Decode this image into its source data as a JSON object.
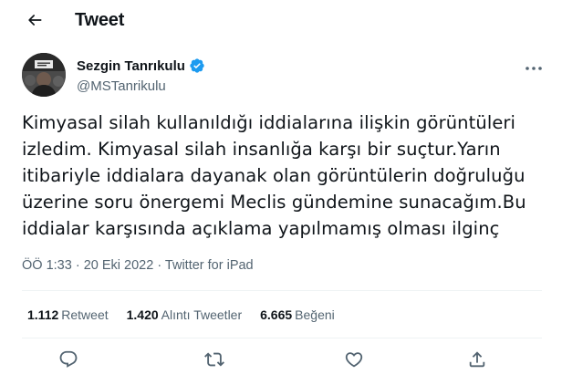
{
  "header": {
    "title": "Tweet",
    "back_icon": "arrow-left-icon"
  },
  "author": {
    "display_name": "Sezgin Tanrıkulu",
    "handle": "@MSTanrikulu",
    "verified_icon": "verified-badge-icon",
    "verified_color": "#1d9bf0",
    "more_icon": "more-horizontal-icon"
  },
  "tweet": {
    "lines": [
      "Kimyasal silah kullanıldığı iddialarına ilişkin  görüntüleri",
      "izledim. Kimyasal silah insanlığa karşı bir suçtur.Yarın",
      "itibariyle iddialara dayanak olan görüntülerin doğruluğu",
      "üzerine soru önergemi Meclis gündemine sunacağım.Bu",
      "iddialar karşısında açıklama yapılmamış olması ilginç"
    ]
  },
  "meta": {
    "time": "ÖÖ 1:33",
    "date": "20 Eki 2022",
    "source": "Twitter for iPad",
    "separator": " · "
  },
  "stats": {
    "retweets": {
      "count": "1.112",
      "label": "Retweet"
    },
    "quotes": {
      "count": "1.420",
      "label": "Alıntı Tweetler"
    },
    "likes": {
      "count": "6.665",
      "label": "Beğeni"
    }
  },
  "actions": [
    "reply-icon",
    "retweet-icon",
    "like-icon",
    "share-icon"
  ],
  "colors": {
    "text": "#0f1419",
    "secondary": "#536471",
    "divider": "#eff3f4"
  }
}
